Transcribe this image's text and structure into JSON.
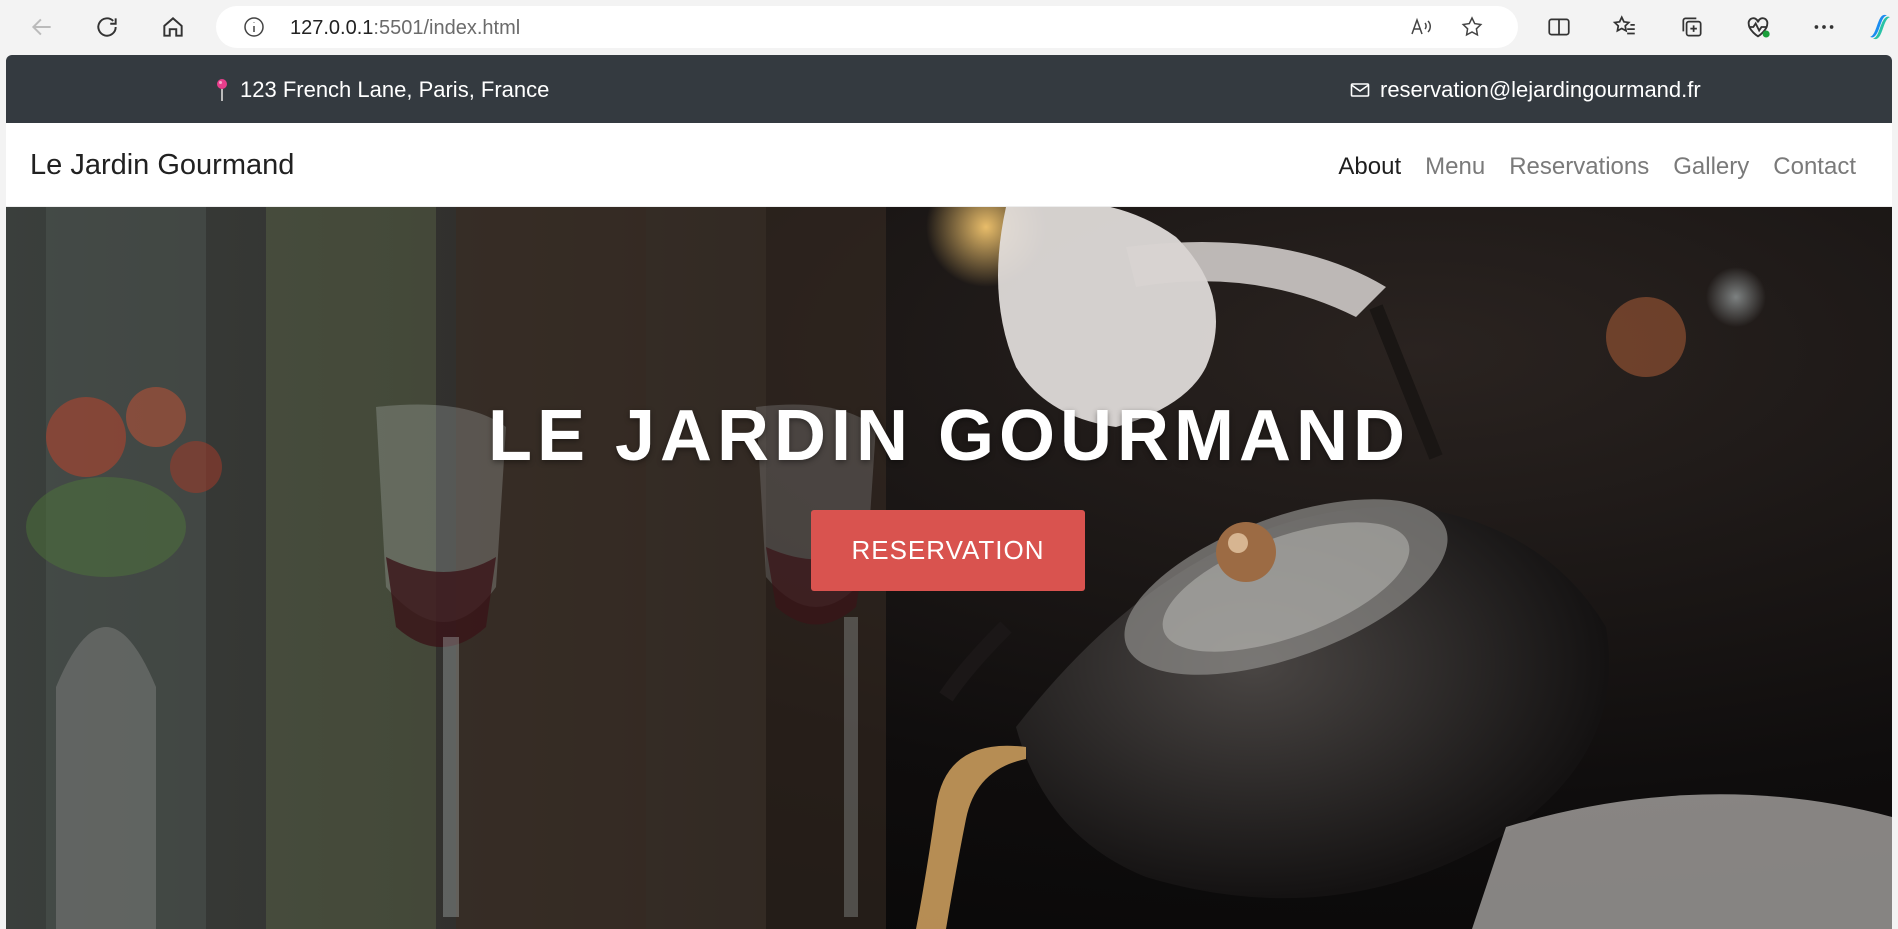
{
  "browser": {
    "url_host": "127.0.0.1",
    "url_rest": ":5501/index.html"
  },
  "topbar": {
    "address": "123 French Lane, Paris, France",
    "email": "reservation@lejardingourmand.fr"
  },
  "navbar": {
    "brand": "Le Jardin Gourmand",
    "links": [
      "About",
      "Menu",
      "Reservations",
      "Gallery",
      "Contact"
    ],
    "active": "About"
  },
  "hero": {
    "title": "LE JARDIN GOURMAND",
    "button": "RESERVATION"
  },
  "colors": {
    "topbar_bg": "#343a40",
    "accent": "#d9534f"
  }
}
